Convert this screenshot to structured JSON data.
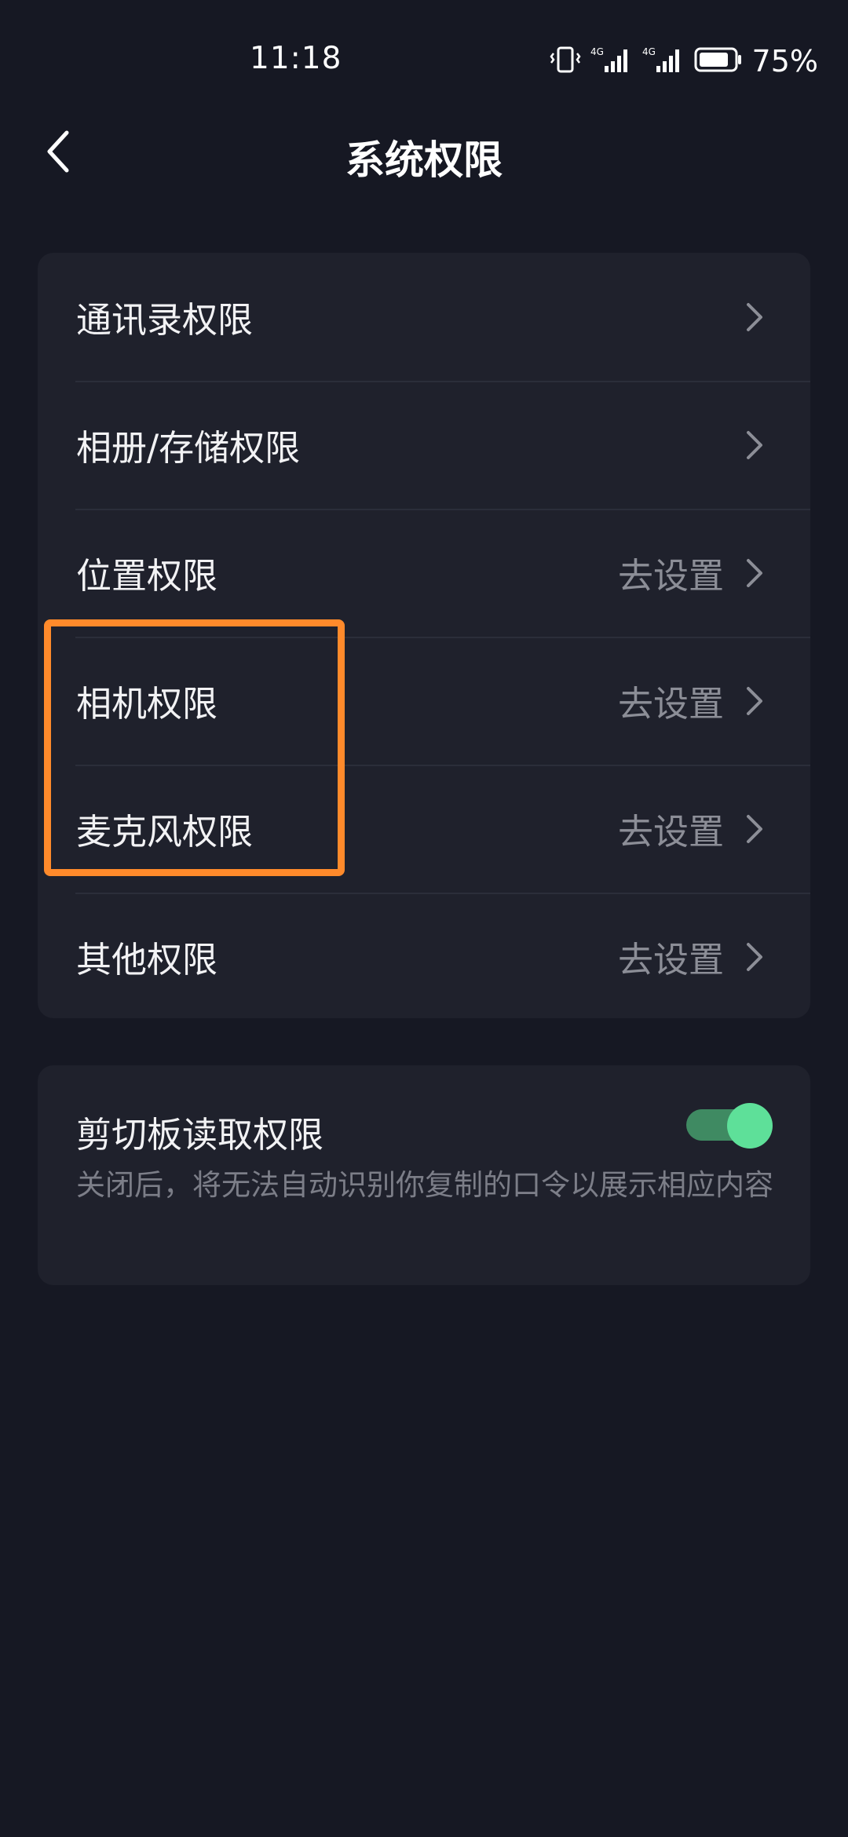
{
  "status_bar": {
    "time": "11:18",
    "icons": [
      "vibrate-icon",
      "signal-4g-icon",
      "signal-4g-icon",
      "battery-icon"
    ],
    "battery_percent": "75%"
  },
  "header": {
    "title": "系统权限",
    "back_icon": "chevron-left-icon"
  },
  "permissions": {
    "items": [
      {
        "label": "通讯录权限",
        "action": ""
      },
      {
        "label": "相册/存储权限",
        "action": ""
      },
      {
        "label": "位置权限",
        "action": "去设置"
      },
      {
        "label": "相机权限",
        "action": "去设置"
      },
      {
        "label": "麦克风权限",
        "action": "去设置"
      },
      {
        "label": "其他权限",
        "action": "去设置"
      }
    ]
  },
  "clipboard": {
    "title": "剪切板读取权限",
    "description": "关闭后，将无法自动识别你复制的口令以展示相应内容",
    "enabled": true
  },
  "colors": {
    "background": "#161823",
    "card": "#1f212c",
    "toggle_on": "#5ee099",
    "highlight": "#ff8a2b"
  }
}
